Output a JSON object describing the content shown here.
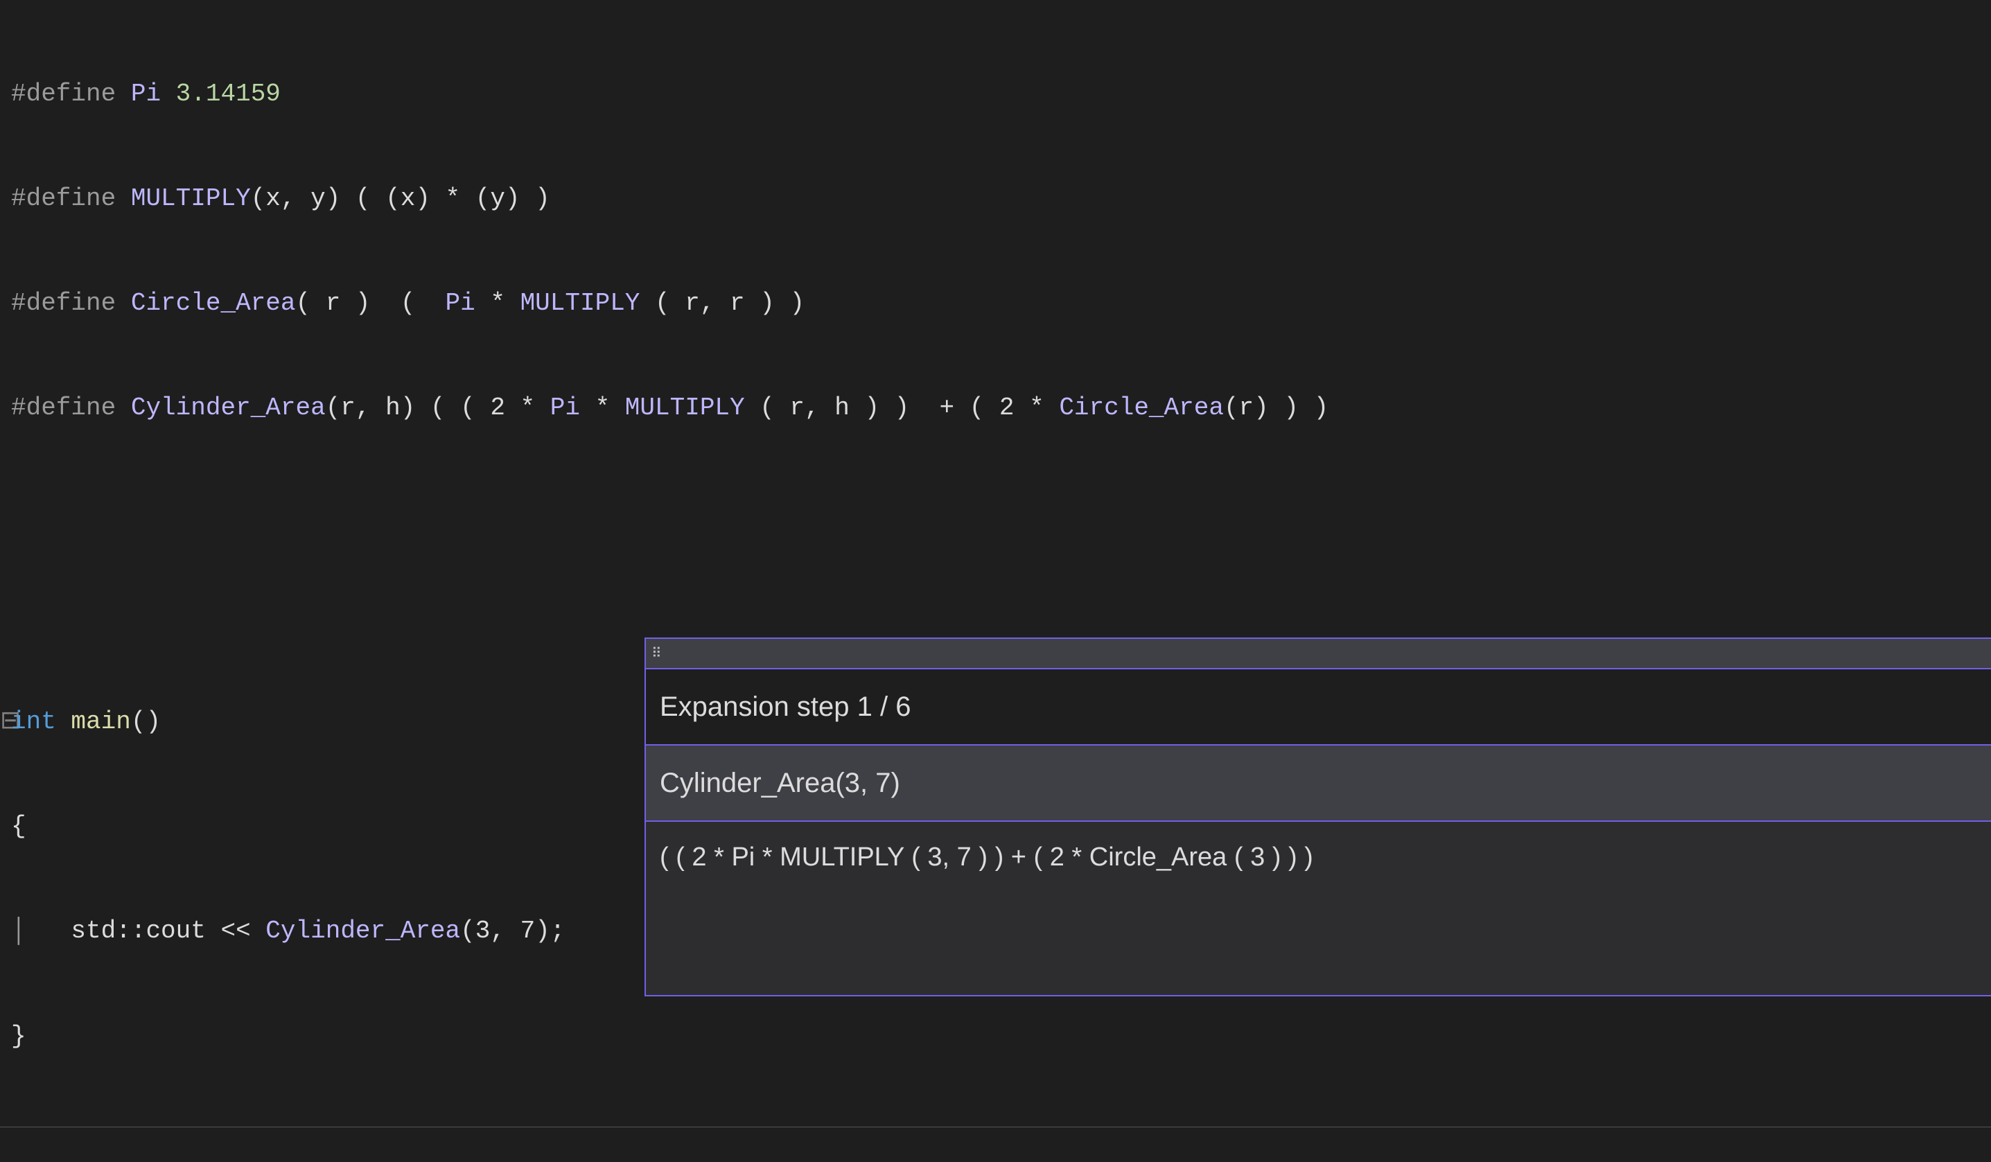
{
  "code": {
    "line1": {
      "define": "#define",
      "name": "Pi",
      "value": "3.14159"
    },
    "line2": {
      "define": "#define",
      "name": "MULTIPLY",
      "params": "(x, y)",
      "body": " ( (x) * (y) )"
    },
    "line3": {
      "define": "#define",
      "name": "Circle_Area",
      "params": "( r )",
      "body_pre": "  (  ",
      "body_pi": "Pi",
      "body_mid": " * ",
      "body_mult": "MULTIPLY",
      "body_post": " ( r, r ) )"
    },
    "line4": {
      "define": "#define",
      "name": "Cylinder_Area",
      "params": "(r, h)",
      "body_pre": " ( ( 2 * ",
      "body_pi": "Pi",
      "body_mid": " * ",
      "body_mult": "MULTIPLY",
      "body_mid2": " ( r, h ) )  + ( 2 * ",
      "body_circle": "Circle_Area",
      "body_post": "(r) ) )"
    },
    "main": {
      "int": "int",
      "name": "main",
      "parens": "()",
      "open_brace": "{",
      "std": "std",
      "scope": "::",
      "cout": "cout",
      "op": " << ",
      "call": "Cylinder_Area",
      "args": "(3, 7);",
      "close_brace": "}"
    }
  },
  "popup": {
    "step_label": "Expansion step 1 / 6",
    "macro_call": "Cylinder_Area(3, 7)",
    "expansion": "( ( 2 * Pi * MULTIPLY ( 3, 7 ) ) + ( 2 * Circle_Area ( 3 ) ) )"
  }
}
